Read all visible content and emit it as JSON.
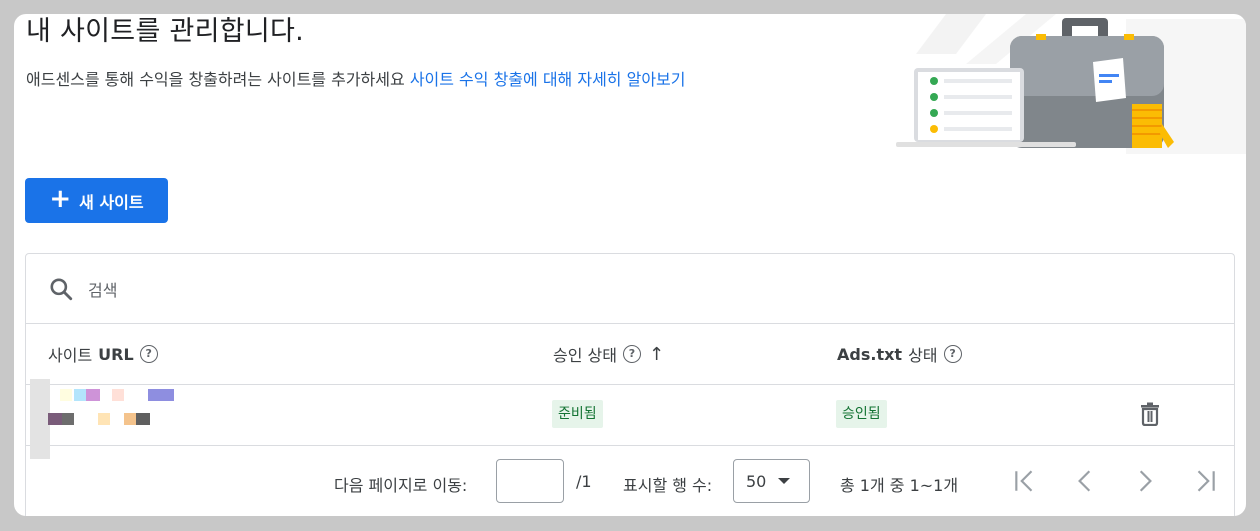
{
  "header": {
    "title": "내 사이트를 관리합니다.",
    "subtitle": "애드센스를 통해 수익을 창출하려는 사이트를 추가하세요",
    "learn_more": "사이트 수익 창출에 대해 자세히 알아보기"
  },
  "toolbar": {
    "new_site_label": "새 사이트",
    "new_site_icon": "plus-icon"
  },
  "search": {
    "placeholder": "검색"
  },
  "table": {
    "columns": {
      "site_url_prefix": "사이트",
      "site_url_suffix": "URL",
      "approval": "승인 상태",
      "ads_txt_prefix": "Ads.txt",
      "ads_txt_suffix": "상태"
    },
    "rows": [
      {
        "approval_status": "준비됨",
        "ads_txt_status": "승인됨"
      }
    ]
  },
  "pagination": {
    "goto_label": "다음 페이지로 이동:",
    "page_input": "",
    "total_pages": "/1",
    "rows_label": "표시할 행 수:",
    "rows_value": "50",
    "range_text": "총 1개 중 1~1개"
  },
  "colors": {
    "accent": "#1a73e8",
    "chip_bg": "#e6f4ea",
    "chip_text": "#137333",
    "icon": "#5f6368"
  }
}
